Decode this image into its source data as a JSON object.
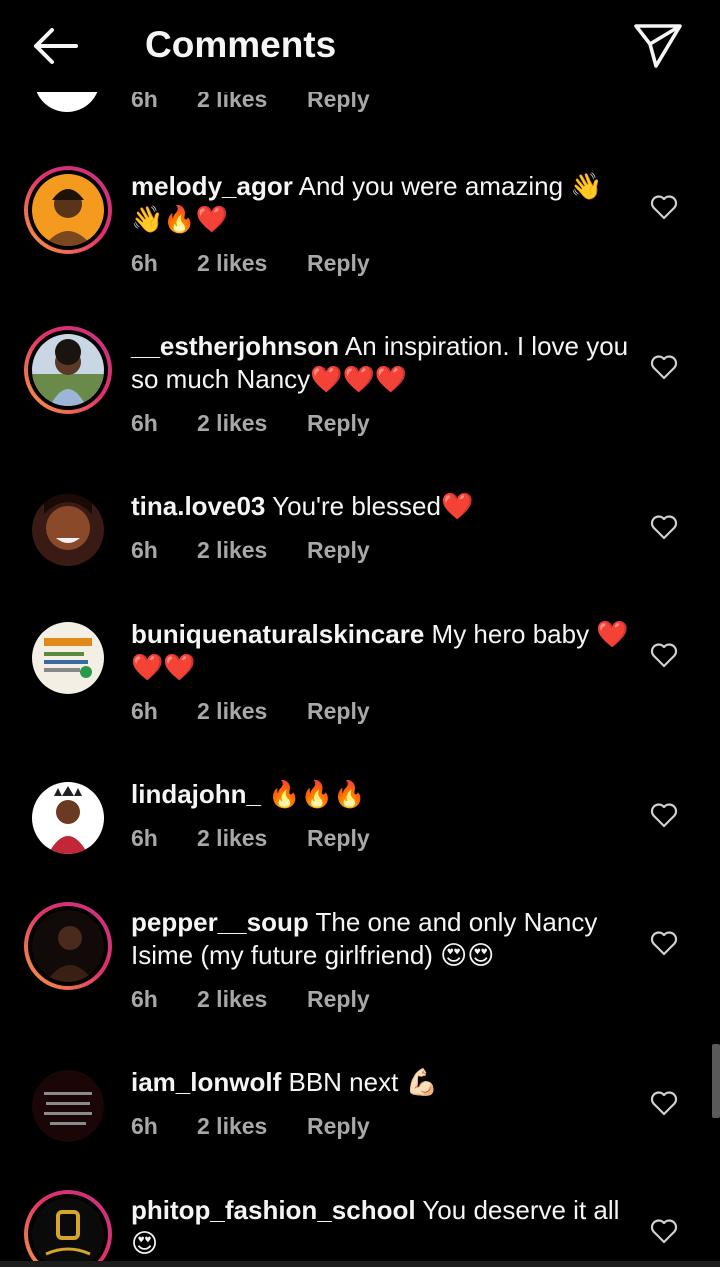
{
  "header": {
    "title": "Comments",
    "back_icon": "arrow-left-icon",
    "send_icon": "paper-plane-icon"
  },
  "partial_comment": {
    "time": "6h",
    "likes": "2 likes",
    "reply": "Reply"
  },
  "comments": [
    {
      "username": "melody_agor",
      "text": "And you were amazing 👋👋🔥❤️",
      "time": "6h",
      "likes": "2 likes",
      "reply": "Reply"
    },
    {
      "username": "__estherjohnson",
      "text": "An inspiration. I love you so much Nancy❤️❤️❤️",
      "time": "6h",
      "likes": "2 likes",
      "reply": "Reply"
    },
    {
      "username": "tina.love03",
      "text": "You're blessed❤️",
      "time": "6h",
      "likes": "2 likes",
      "reply": "Reply"
    },
    {
      "username": "buniquenaturalskincare",
      "text": "My hero baby ❤️❤️❤️",
      "time": "6h",
      "likes": "2 likes",
      "reply": "Reply"
    },
    {
      "username": "lindajohn_",
      "text": "🔥🔥🔥",
      "time": "6h",
      "likes": "2 likes",
      "reply": "Reply"
    },
    {
      "username": "pepper__soup",
      "text": "The one and only Nancy Isime (my future girlfriend) 😍😍",
      "time": "6h",
      "likes": "2 likes",
      "reply": "Reply"
    },
    {
      "username": "iam_lonwolf",
      "text": "BBN next 💪🏻",
      "time": "6h",
      "likes": "2 likes",
      "reply": "Reply"
    },
    {
      "username": "phitop_fashion_school",
      "text": "You deserve it all😍"
    }
  ],
  "colors": {
    "background": "#000000",
    "text": "#f5f5f5",
    "meta": "#a8a8a8",
    "story_ring_start": "#f9a03f",
    "story_ring_end": "#c13584"
  }
}
